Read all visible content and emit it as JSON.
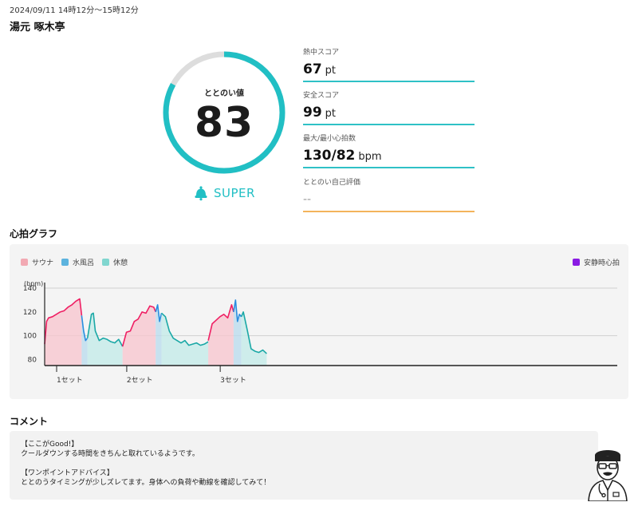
{
  "header": {
    "datetime": "2024/09/11 14時12分〜15時12分",
    "place": "湯元 啄木亭"
  },
  "score": {
    "label": "ととのい値",
    "value": "83",
    "rank": "SUPER",
    "rank_icon": "bell-icon",
    "ring_fraction": 0.83,
    "ring_color": "#21bfc4",
    "ring_track_color": "#dddddd"
  },
  "metrics": [
    {
      "label": "熱中スコア",
      "value": "67",
      "unit": "pt"
    },
    {
      "label": "安全スコア",
      "value": "99",
      "unit": "pt"
    },
    {
      "label": "最大/最小心拍数",
      "value": "130/82",
      "unit": "bpm"
    },
    {
      "label": "ととのい自己評価",
      "value": "--",
      "unit": ""
    }
  ],
  "graph": {
    "title": "心拍グラフ",
    "legend": [
      {
        "label": "サウナ",
        "color": "#f2a9b3"
      },
      {
        "label": "水風呂",
        "color": "#5cb3de"
      },
      {
        "label": "休憩",
        "color": "#80d6cf"
      }
    ],
    "legend_right": {
      "label": "安静時心拍",
      "color": "#8a1be3"
    }
  },
  "chart_data": {
    "type": "line",
    "ylabel": "(bpm)",
    "y_ticks": [
      140,
      120,
      100,
      80
    ],
    "ylim": [
      75,
      142
    ],
    "x_ticks": [
      "1セット",
      "2セット",
      "3セット"
    ],
    "x_tick_positions": [
      0,
      18,
      42
    ],
    "xlim": [
      0,
      147
    ],
    "grid": true,
    "series": [
      {
        "name": "サウナ",
        "color": "#ef1f63",
        "fill": "#f7c7cf",
        "x": [
          0,
          0.5,
          1,
          2,
          3,
          4,
          5,
          6,
          7,
          8,
          9,
          9.5
        ],
        "y": [
          93,
          112,
          115,
          116,
          118,
          120,
          121,
          124,
          126,
          129,
          131,
          117
        ]
      },
      {
        "name": "水風呂",
        "color": "#2a8de0",
        "fill": "#bcdcee",
        "x": [
          9.5,
          10,
          10.5,
          11
        ],
        "y": [
          117,
          104,
          96,
          98
        ]
      },
      {
        "name": "休憩",
        "color": "#1aa8a6",
        "fill": "#c4ebe8",
        "x": [
          11,
          12,
          12.5,
          13,
          14,
          15,
          16,
          17,
          18,
          19,
          20
        ],
        "y": [
          98,
          118,
          119,
          104,
          96,
          98,
          97,
          95,
          94,
          97,
          91
        ]
      },
      {
        "name": "サウナ",
        "color": "#ef1f63",
        "fill": "#f7c7cf",
        "x": [
          20,
          21,
          22,
          23,
          24,
          25,
          26,
          27,
          28,
          28.5
        ],
        "y": [
          91,
          103,
          104,
          112,
          114,
          120,
          119,
          125,
          124,
          120
        ]
      },
      {
        "name": "水風呂",
        "color": "#2a8de0",
        "fill": "#bcdcee",
        "x": [
          28.5,
          29,
          29.5,
          30
        ],
        "y": [
          120,
          126,
          112,
          119
        ]
      },
      {
        "name": "休憩",
        "color": "#1aa8a6",
        "fill": "#c4ebe8",
        "x": [
          30,
          31,
          32,
          33,
          34,
          35,
          36,
          37,
          38,
          39,
          40,
          41,
          42
        ],
        "y": [
          119,
          116,
          104,
          98,
          96,
          94,
          96,
          92,
          93,
          94,
          92,
          93,
          95
        ]
      },
      {
        "name": "サウナ",
        "color": "#ef1f63",
        "fill": "#f7c7cf",
        "x": [
          42,
          43,
          44,
          45,
          46,
          47,
          48,
          48.5
        ],
        "y": [
          96,
          110,
          113,
          116,
          118,
          115,
          126,
          120
        ]
      },
      {
        "name": "水風呂",
        "color": "#2a8de0",
        "fill": "#bcdcee",
        "x": [
          48.5,
          49,
          49.5,
          50,
          50.5
        ],
        "y": [
          120,
          130,
          112,
          118,
          116
        ]
      },
      {
        "name": "休憩",
        "color": "#1aa8a6",
        "fill": "#c4ebe8",
        "x": [
          50.5,
          51,
          52,
          53,
          54,
          55,
          56,
          57
        ],
        "y": [
          116,
          120,
          105,
          89,
          87,
          86,
          88,
          85
        ]
      }
    ]
  },
  "comment": {
    "title": "コメント",
    "lines": [
      "【ここがGood!】",
      "クールダウンする時間をきちんと取れているようです。",
      "",
      "【ワンポイントアドバイス】",
      "ととのうタイミングが少しズレてます。身体への負荷や動線を確認してみて！"
    ],
    "avatar_icon": "doctor-avatar-icon"
  }
}
